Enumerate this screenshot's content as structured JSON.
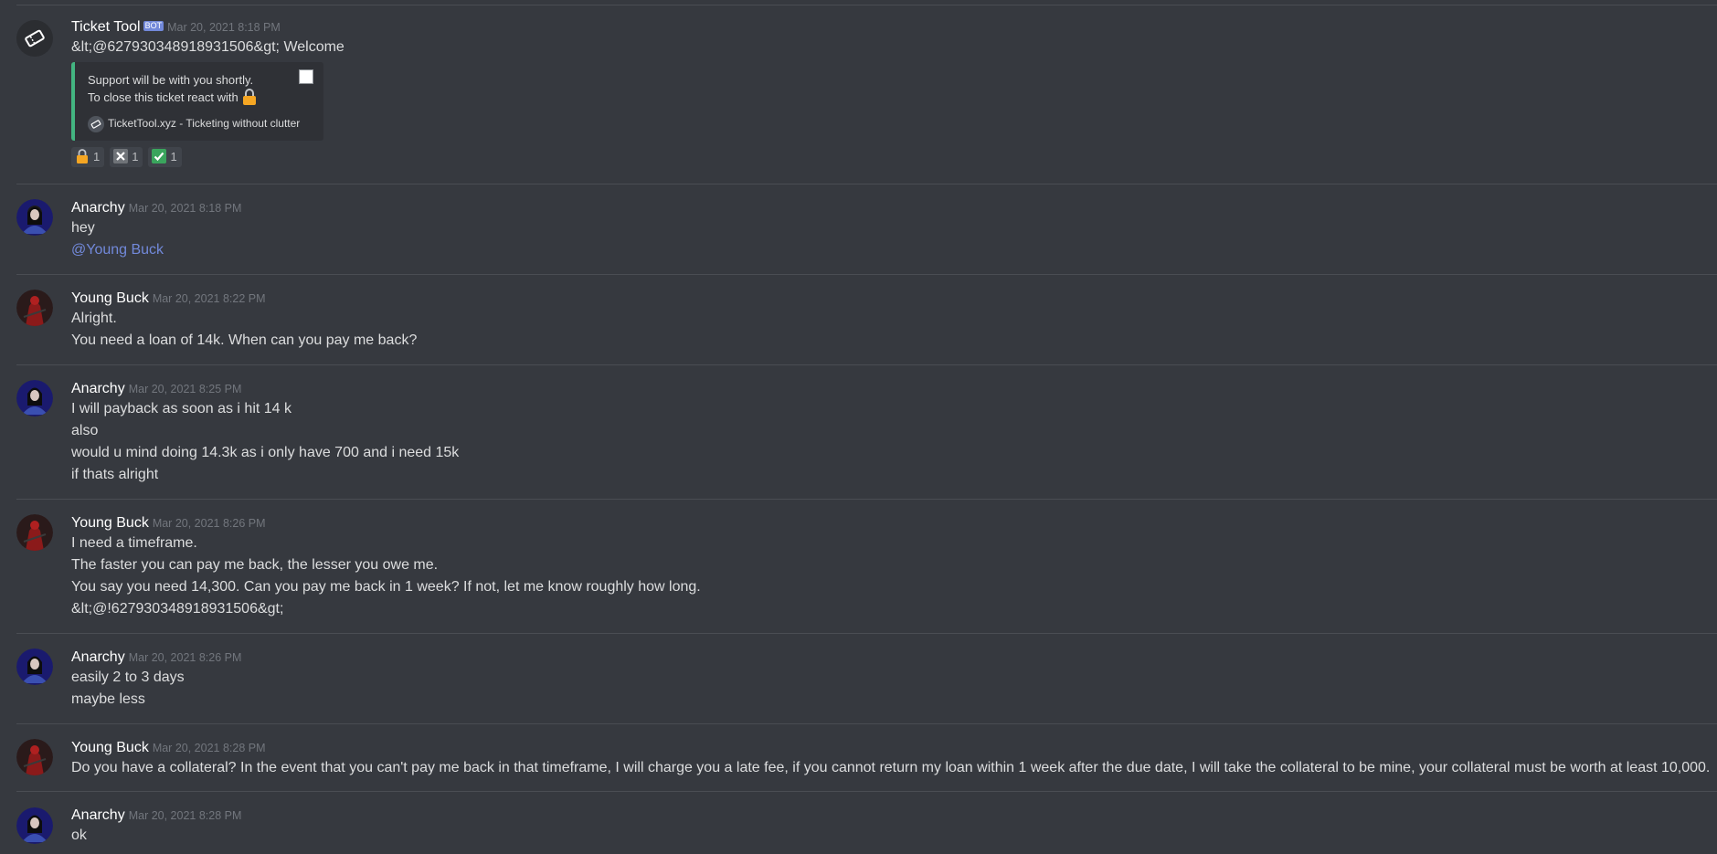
{
  "messages": [
    {
      "author": "Ticket Tool",
      "bot_tag": "BOT",
      "timestamp": "Mar 20, 2021 8:18 PM",
      "lines": [
        "&lt;@627930348918931506&gt; Welcome"
      ],
      "embed": {
        "line1": "Support will be with you shortly.",
        "line2": "To close this ticket react with",
        "footer": "TicketTool.xyz - Ticketing without clutter"
      },
      "reactions": [
        {
          "icon": "lock-icon",
          "count": "1"
        },
        {
          "icon": "cross-mark-icon",
          "count": "1"
        },
        {
          "icon": "check-mark-icon",
          "count": "1"
        }
      ]
    },
    {
      "author": "Anarchy",
      "timestamp": "Mar 20, 2021 8:18 PM",
      "lines": [
        "hey"
      ],
      "mention": "@Young Buck"
    },
    {
      "author": "Young Buck",
      "timestamp": "Mar 20, 2021 8:22 PM",
      "lines": [
        "Alright.",
        "You need a loan of 14k. When can you pay me back?"
      ]
    },
    {
      "author": "Anarchy",
      "timestamp": "Mar 20, 2021 8:25 PM",
      "lines": [
        "I will payback as soon as i hit 14 k",
        "also",
        "would u mind doing 14.3k as i only have 700 and i need 15k",
        "if thats alright"
      ]
    },
    {
      "author": "Young Buck",
      "timestamp": "Mar 20, 2021 8:26 PM",
      "lines": [
        "I need a timeframe.",
        "The faster you can pay me back, the lesser you owe me.",
        "You say you need 14,300. Can you pay me back in 1 week? If not, let me know roughly how long.",
        "&lt;@!627930348918931506&gt;"
      ]
    },
    {
      "author": "Anarchy",
      "timestamp": "Mar 20, 2021 8:26 PM",
      "lines": [
        "easily 2 to 3 days",
        "maybe less"
      ]
    },
    {
      "author": "Young Buck",
      "timestamp": "Mar 20, 2021 8:28 PM",
      "lines": [
        "Do you have a collateral? In the event that you can't pay me back in that timeframe, I will charge you a late fee, if you cannot return my loan within 1 week after the due date, I will take the collateral to be mine, your collateral must be worth at least 10,000."
      ]
    },
    {
      "author": "Anarchy",
      "timestamp": "Mar 20, 2021 8:28 PM",
      "lines": [
        "ok"
      ]
    }
  ],
  "colors": {
    "background": "#36393f",
    "embed_accent": "#43b581",
    "mention": "#7289da",
    "bot_tag": "#7289da"
  }
}
